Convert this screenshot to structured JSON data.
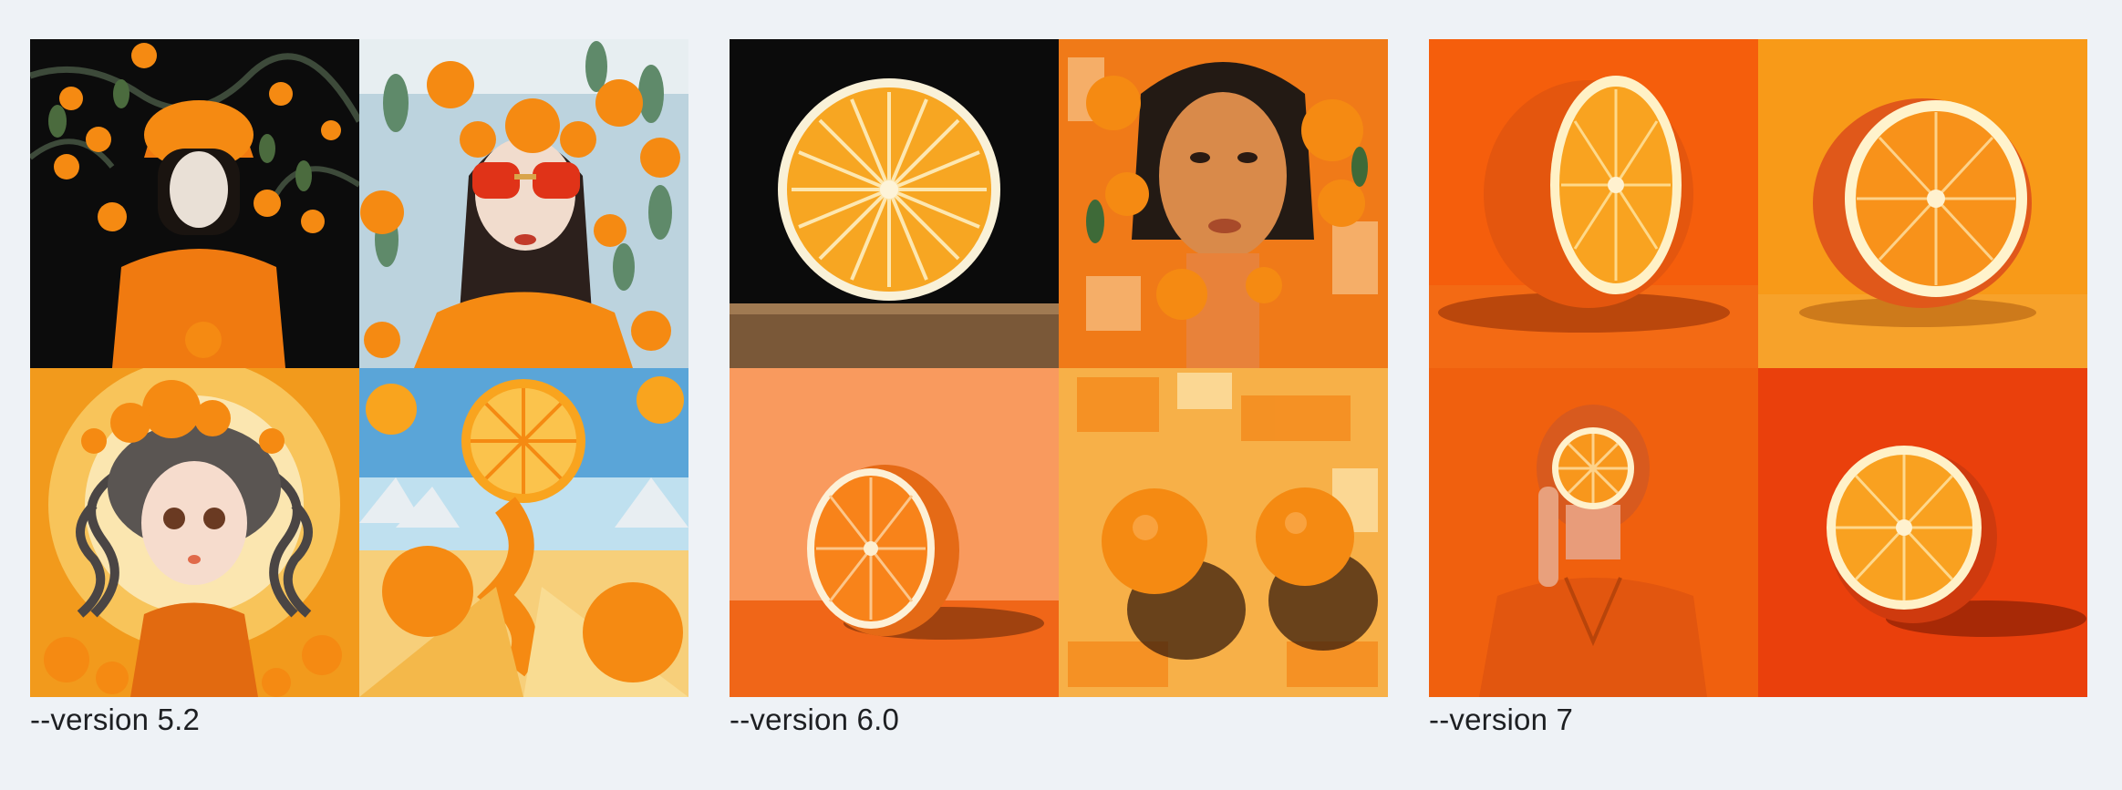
{
  "groups": [
    {
      "caption": "--version 5.2"
    },
    {
      "caption": "--version 6.0"
    },
    {
      "caption": "--version 7"
    }
  ],
  "colors": {
    "background": "#eef2f6",
    "orange": "#f58a12",
    "deep_orange": "#e5550d",
    "caption_text": "#1d1f22"
  }
}
